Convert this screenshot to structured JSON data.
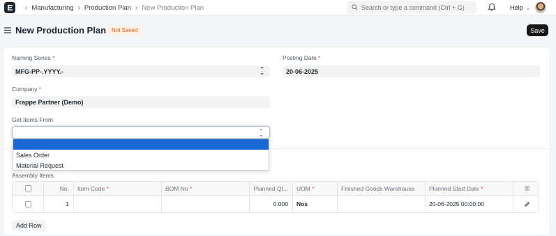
{
  "navbar": {
    "breadcrumbs": [
      "Manufacturing",
      "Production Plan",
      "New Production Plan"
    ],
    "search_placeholder": "Search or type a command (Ctrl + G)",
    "help_label": "Help"
  },
  "page": {
    "title": "New Production Plan",
    "status_badge": "Not Saved",
    "save_label": "Save"
  },
  "form": {
    "naming_series": {
      "label": "Naming Series",
      "value": "MFG-PP-.YYYY.-"
    },
    "posting_date": {
      "label": "Posting Date",
      "value": "20-06-2025"
    },
    "company": {
      "label": "Company",
      "value": "Frappe Partner (Demo)"
    },
    "get_items_from": {
      "label": "Get Items From",
      "value": "",
      "options": [
        "",
        "Sales Order",
        "Material Request"
      ]
    }
  },
  "assembly_items": {
    "label": "Assembly Items",
    "columns": [
      "No.",
      "Item Code",
      "BOM No",
      "Planned Qt...",
      "UOM",
      "Finished Goods Warehouse",
      "Planned Start Date"
    ],
    "required_columns": [
      "Item Code",
      "BOM No",
      "UOM",
      "Planned Start Date"
    ],
    "rows": [
      {
        "no": "1",
        "item_code": "",
        "bom_no": "",
        "planned_qty": "0.000",
        "uom": "Nos",
        "warehouse": "",
        "planned_start_date": "20-06-2025 00:00:00"
      }
    ],
    "add_row_label": "Add Row"
  },
  "required_marker": "*",
  "icons": [
    "app-logo",
    "chevron-right-icon",
    "search-icon",
    "bell-icon",
    "chevron-down-icon",
    "hamburger-icon",
    "select-updown-icon",
    "settings-icon",
    "edit-icon"
  ],
  "colors": {
    "accent": "#1b67d5",
    "badge_text": "#d15d1a",
    "badge_bg": "#fff0e6",
    "primary_button": "#171717"
  }
}
